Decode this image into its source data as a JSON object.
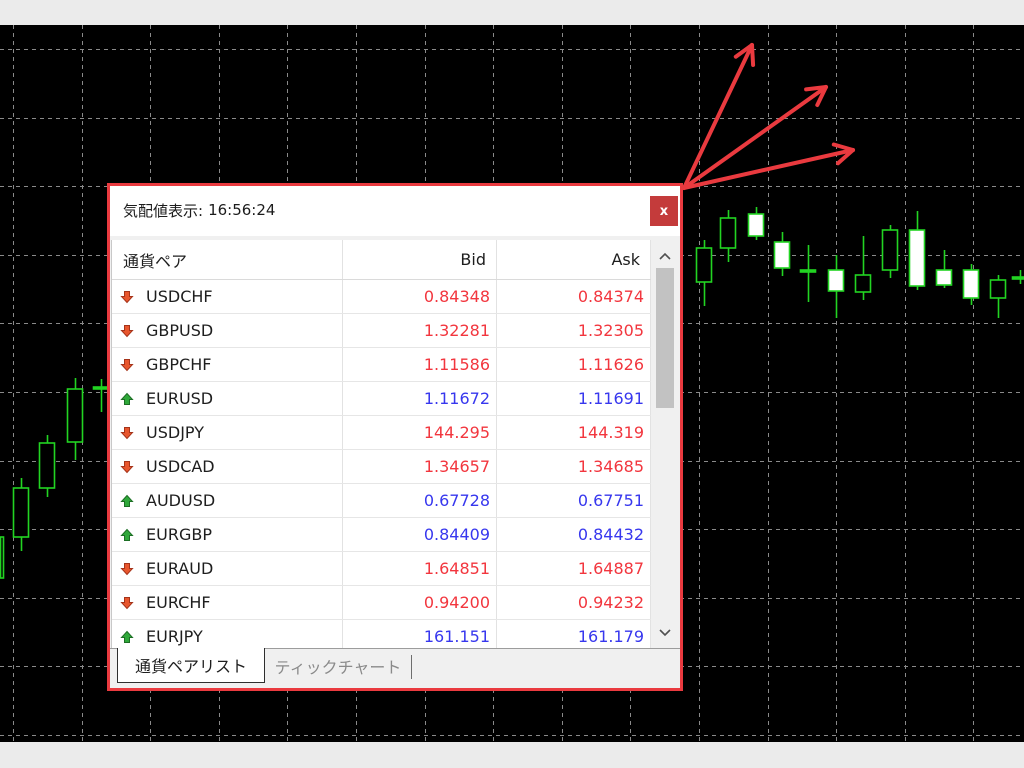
{
  "colors": {
    "chart_background": "#000000",
    "chart_grid": "#8a8a8a",
    "candle_outline": "#22d422",
    "annotation_arrows": "#ea3a3f",
    "window_border": "#ea3a3f",
    "close_button": "#c43b3b",
    "price_down": "#f2363e",
    "price_up": "#3737ee",
    "arrow_down_icon": "#e8562d",
    "arrow_up_icon": "#2fa83a"
  },
  "market_watch": {
    "title_label": "気配値表示:",
    "time": "16:56:24",
    "close_label": "x",
    "columns": {
      "symbol": "通貨ペア",
      "bid": "Bid",
      "ask": "Ask"
    },
    "rows": [
      {
        "icon": "arrow-down-icon",
        "symbol": "USDCHF",
        "bid": "0.84348",
        "ask": "0.84374"
      },
      {
        "icon": "arrow-down-icon",
        "symbol": "GBPUSD",
        "bid": "1.32281",
        "ask": "1.32305"
      },
      {
        "icon": "arrow-down-icon",
        "symbol": "GBPCHF",
        "bid": "1.11586",
        "ask": "1.11626"
      },
      {
        "icon": "arrow-up-icon",
        "symbol": "EURUSD",
        "bid": "1.11672",
        "ask": "1.11691"
      },
      {
        "icon": "arrow-down-icon",
        "symbol": "USDJPY",
        "bid": "144.295",
        "ask": "144.319"
      },
      {
        "icon": "arrow-down-icon",
        "symbol": "USDCAD",
        "bid": "1.34657",
        "ask": "1.34685"
      },
      {
        "icon": "arrow-up-icon",
        "symbol": "AUDUSD",
        "bid": "0.67728",
        "ask": "0.67751"
      },
      {
        "icon": "arrow-up-icon",
        "symbol": "EURGBP",
        "bid": "0.84409",
        "ask": "0.84432"
      },
      {
        "icon": "arrow-down-icon",
        "symbol": "EURAUD",
        "bid": "1.64851",
        "ask": "1.64887"
      },
      {
        "icon": "arrow-down-icon",
        "symbol": "EURCHF",
        "bid": "0.94200",
        "ask": "0.94232"
      },
      {
        "icon": "arrow-up-icon",
        "symbol": "EURJPY",
        "bid": "161.151",
        "ask": "161.179"
      }
    ],
    "tabs": [
      {
        "label": "通貨ペアリスト",
        "active": true
      },
      {
        "label": "ティックチャート",
        "active": false
      }
    ]
  }
}
